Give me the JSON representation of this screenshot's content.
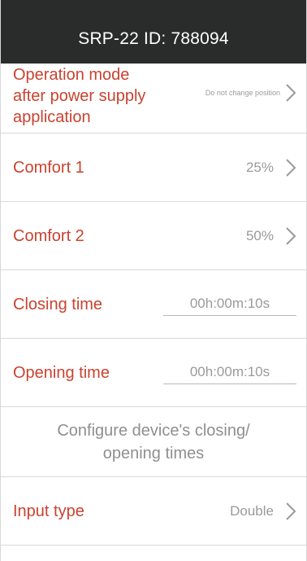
{
  "header": {
    "title": "SRP-22 ID: 788094"
  },
  "settings": [
    {
      "label_lines": [
        "Operation mode",
        "after power supply",
        "application"
      ],
      "value": "Do not change position"
    },
    {
      "label": "Comfort 1",
      "value": "25%"
    },
    {
      "label": "Comfort 2",
      "value": "50%"
    },
    {
      "label": "Closing time",
      "field_value": "00h:00m:10s"
    },
    {
      "label": "Opening time",
      "field_value": "00h:00m:10s"
    },
    {
      "note_lines": [
        "Configure device's closing/",
        "opening times"
      ]
    },
    {
      "label": "Input type",
      "value": "Double"
    }
  ],
  "colors": {
    "header_bg": "#2a2b2b",
    "label": "#c8432f",
    "value": "#9a9a9a",
    "divider": "#d9d9d9"
  },
  "icons": {
    "chevron": "chevron-right-icon"
  }
}
